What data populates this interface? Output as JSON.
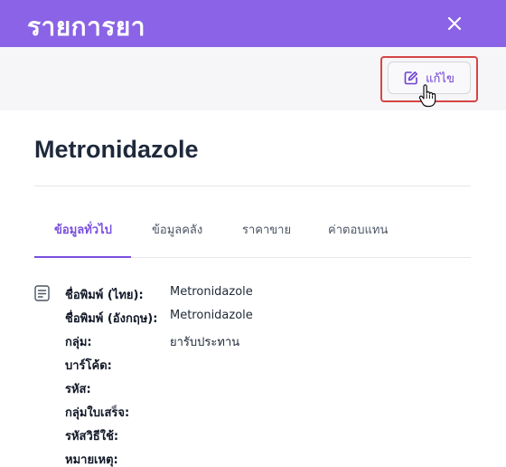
{
  "modal": {
    "title": "รายการยา",
    "edit_label": "แก้ไข"
  },
  "drug": {
    "name": "Metronidazole"
  },
  "tabs": [
    {
      "label": "ข้อมูลทั่วไป",
      "active": true
    },
    {
      "label": "ข้อมูลคลัง",
      "active": false
    },
    {
      "label": "ราคาขาย",
      "active": false
    },
    {
      "label": "ค่าตอบแทน",
      "active": false
    }
  ],
  "fields": [
    {
      "key": "ชื่อพิมพ์ (ไทย):",
      "value": "Metronidazole"
    },
    {
      "key": "ชื่อพิมพ์ (อังกฤษ):",
      "value": "Metronidazole"
    },
    {
      "key": "กลุ่ม:",
      "value": "ยารับประทาน"
    },
    {
      "key": "บาร์โค้ด:",
      "value": ""
    },
    {
      "key": "รหัส:",
      "value": ""
    },
    {
      "key": "กลุ่มใบเสร็จ:",
      "value": ""
    },
    {
      "key": "รหัสวิธีใช้:",
      "value": ""
    },
    {
      "key": "หมายเหตุ:",
      "value": ""
    }
  ],
  "colors": {
    "header": "#8a63e6",
    "accent": "#7b4fe0",
    "highlight": "#d64545"
  },
  "icons": {
    "close": "close-icon",
    "edit": "edit-icon",
    "document": "document-icon",
    "cursor": "hand-pointer-icon"
  }
}
